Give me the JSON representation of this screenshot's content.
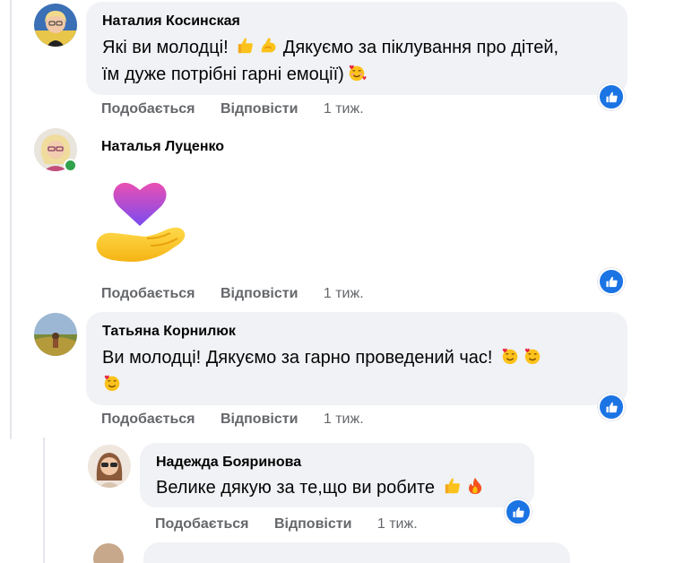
{
  "comments": [
    {
      "author": "Наталия Косинская",
      "text": "Які ви молодці! 👍💪 Дякуємо за піклування про дітей, їм дуже потрібні гарні емоції)🥰",
      "text_line1": "Які ви молодці! ",
      "text_line1b": " Дякуємо за піклування про дітей,",
      "text_line2": "їм дуже потрібні гарні емоції)",
      "actions": {
        "like": "Подобається",
        "reply": "Відповісти",
        "time": "1 тиж."
      }
    },
    {
      "author": "Наталья Луценко",
      "sticker": "heart-in-hand-sticker",
      "online": true,
      "actions": {
        "like": "Подобається",
        "reply": "Відповісти",
        "time": "1 тиж."
      }
    },
    {
      "author": "Татьяна Корнилюк",
      "text": "Ви молодці! Дякуємо за гарно проведений час! 🥰🥰🥰",
      "text_line1": "Ви молодці! Дякуємо за гарно проведений час!",
      "actions": {
        "like": "Подобається",
        "reply": "Відповісти",
        "time": "1 тиж."
      }
    }
  ],
  "reply": {
    "author": "Надежда Бояринова",
    "text": "Велике дякую за те,що ви робите 👍🔥",
    "text_line1": "Велике дякую за те,що ви робите",
    "actions": {
      "like": "Подобається",
      "reply": "Відповісти",
      "time": "1 тиж."
    }
  },
  "colors": {
    "bubble": "#f0f2f5",
    "like": "#1b74e4",
    "meta": "#65676b",
    "online": "#31a24c"
  }
}
